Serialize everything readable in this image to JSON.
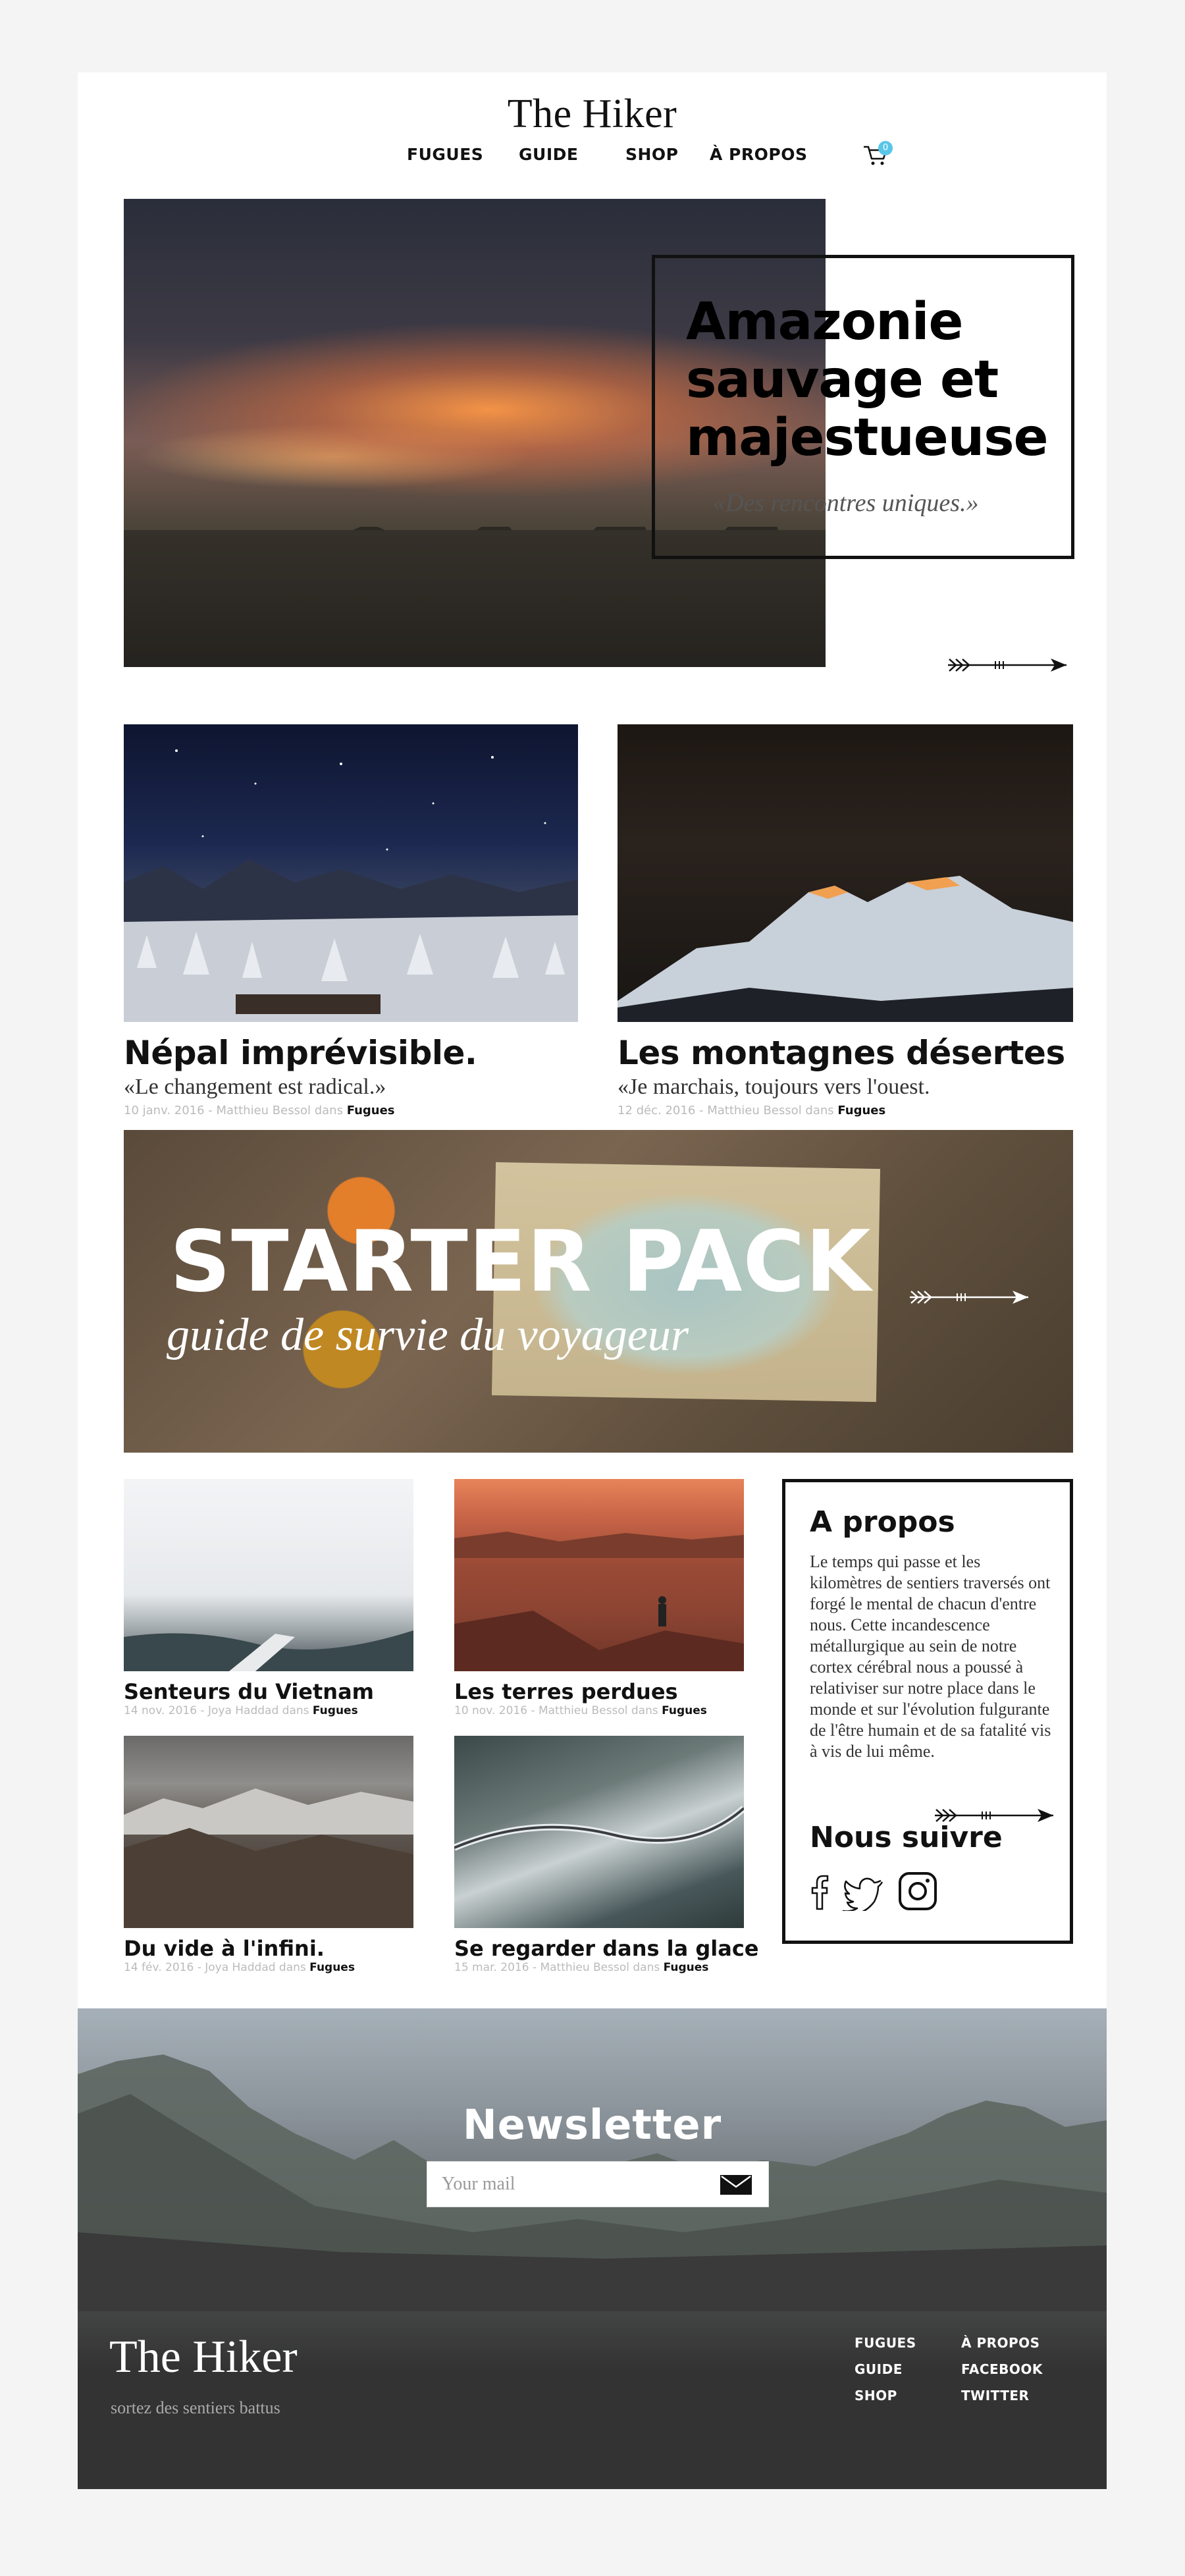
{
  "header": {
    "logo": "The Hiker",
    "nav": [
      "FUGUES",
      "GUIDE",
      "SHOP",
      "À PROPOS"
    ],
    "cart_count": "0"
  },
  "hero": {
    "title": "Amazonie sauvage et majestueuse",
    "subtitle": "«Des rencontres uniques.»"
  },
  "articles": [
    {
      "title": "Népal imprévisible.",
      "subtitle": "«Le changement est radical.»",
      "meta": "10 janv. 2016 - Matthieu Bessol dans ",
      "category": "Fugues"
    },
    {
      "title": "Les montagnes désertes",
      "subtitle": "«Je marchais, toujours vers l'ouest.",
      "meta": "12 déc. 2016 - Matthieu Bessol dans ",
      "category": "Fugues"
    }
  ],
  "banner": {
    "title": "STARTER PACK",
    "subtitle": "guide de survie du voyageur"
  },
  "small_articles": [
    {
      "title": "Senteurs du Vietnam",
      "meta": "14 nov. 2016 - Joya Haddad dans ",
      "category": "Fugues"
    },
    {
      "title": "Les terres perdues",
      "meta": "10 nov. 2016 - Matthieu Bessol dans ",
      "category": "Fugues"
    },
    {
      "title": "Du vide à l'infini.",
      "meta": "14 fév. 2016 - Joya Haddad dans ",
      "category": "Fugues"
    },
    {
      "title": "Se regarder dans la glace",
      "meta": "15 mar. 2016 - Matthieu Bessol dans ",
      "category": "Fugues"
    }
  ],
  "about": {
    "title": "A propos",
    "text": "Le temps qui passe et les kilomètres de sentiers traversés ont forgé le mental de chacun d'entre nous. Cette incandescence métallurgique au sein de notre cortex cérébral nous a poussé à relativiser sur notre place dans le monde et sur l'évolution fulgurante de l'être humain et de sa fatalité vis à vis de lui même.",
    "follow_title": "Nous suivre",
    "social_icons": [
      "facebook-icon",
      "twitter-icon",
      "instagram-icon"
    ]
  },
  "newsletter": {
    "title": "Newsletter",
    "placeholder": "Your mail"
  },
  "footer": {
    "logo": "The Hiker",
    "tagline": "sortez des sentiers battus",
    "links_col1": [
      "FUGUES",
      "GUIDE",
      "SHOP"
    ],
    "links_col2": [
      "À PROPOS",
      "FACEBOOK",
      "TWITTER"
    ]
  },
  "colors": {
    "accent": "#59c6e8",
    "text": "#111111",
    "footer_bg": "#333333"
  }
}
